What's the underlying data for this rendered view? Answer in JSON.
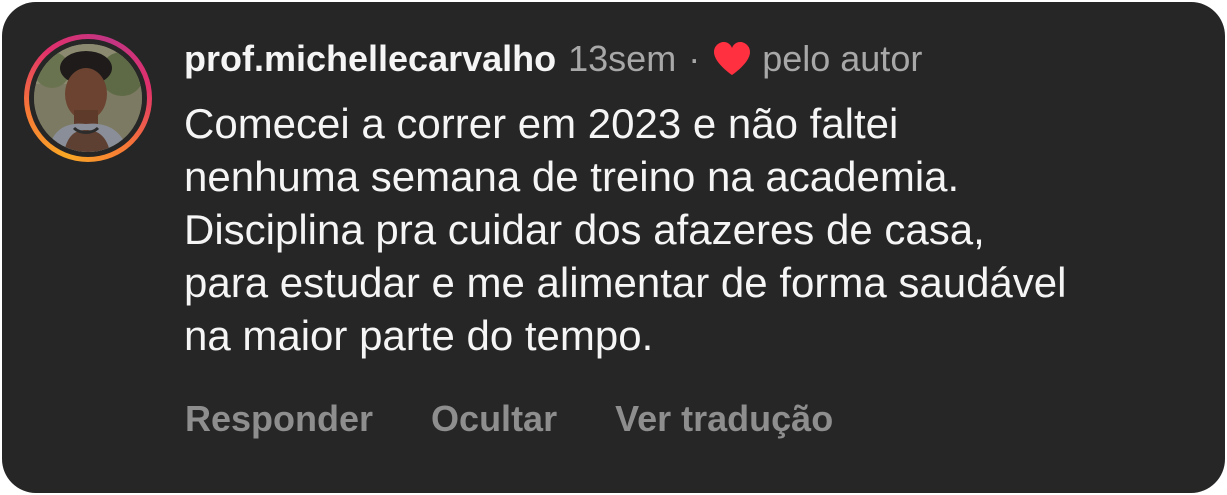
{
  "comment": {
    "author": "prof.michellecarvalho",
    "age": "13sem",
    "separator": "·",
    "liked_by_label": "pelo autor",
    "text_lines": [
      "Comecei a correr em 2023 e não faltei",
      "nenhuma semana de treino na academia.",
      "Disciplina pra cuidar dos afazeres de casa,",
      "para estudar e me alimentar de forma saudável",
      "na maior parte do tempo."
    ],
    "actions": {
      "reply": "Responder",
      "hide": "Ocultar",
      "translate": "Ver tradução"
    }
  },
  "icons": {
    "liked_heart": "heart-icon",
    "avatar_ring": "story-ring"
  },
  "colors": {
    "background": "#262626",
    "primary_text": "#f5f5f5",
    "secondary_text": "#a8a8a8",
    "action_text": "#8e8e8e",
    "heart": "#ff3040"
  }
}
